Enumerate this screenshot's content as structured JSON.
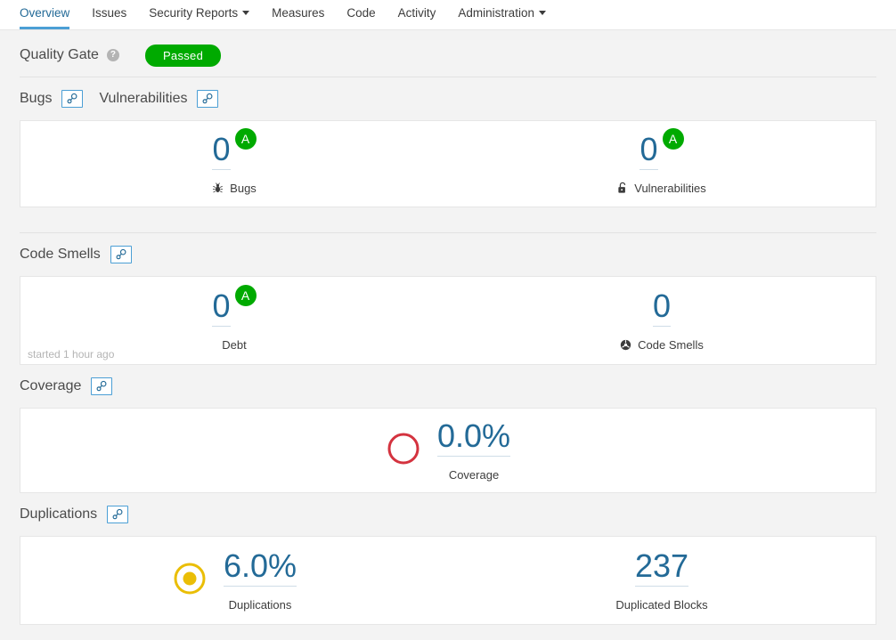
{
  "nav": {
    "items": [
      {
        "label": "Overview",
        "active": true,
        "caret": false
      },
      {
        "label": "Issues",
        "active": false,
        "caret": false
      },
      {
        "label": "Security Reports",
        "active": false,
        "caret": true
      },
      {
        "label": "Measures",
        "active": false,
        "caret": false
      },
      {
        "label": "Code",
        "active": false,
        "caret": false
      },
      {
        "label": "Activity",
        "active": false,
        "caret": false
      },
      {
        "label": "Administration",
        "active": false,
        "caret": true
      }
    ]
  },
  "quality_gate": {
    "title": "Quality Gate",
    "help_glyph": "?",
    "status": "Passed",
    "status_color": "#00aa00"
  },
  "sections": {
    "bugs_vulnerabilities": {
      "title_left": "Bugs",
      "title_right": "Vulnerabilities",
      "left": {
        "value": "0",
        "rating": "A",
        "rating_color": "#00aa00",
        "label": "Bugs",
        "icon": "bug-icon"
      },
      "right": {
        "value": "0",
        "rating": "A",
        "rating_color": "#00aa00",
        "label": "Vulnerabilities",
        "icon": "open-lock-icon"
      }
    },
    "code_smells": {
      "title": "Code Smells",
      "footer": "started 1 hour ago",
      "left": {
        "value": "0",
        "rating": "A",
        "rating_color": "#00aa00",
        "label": "Debt",
        "icon": ""
      },
      "right": {
        "value": "0",
        "rating": "",
        "label": "Code Smells",
        "icon": "code-smell-icon"
      }
    },
    "coverage": {
      "title": "Coverage",
      "value": "0.0%",
      "label": "Coverage",
      "gauge_color": "#d4333f",
      "gauge_fill": 0
    },
    "duplications": {
      "title": "Duplications",
      "left": {
        "value": "6.0%",
        "label": "Duplications",
        "gauge_color": "#eabe06",
        "gauge_fill": 0.45
      },
      "right": {
        "value": "237",
        "label": "Duplicated Blocks"
      }
    }
  },
  "icons": {
    "link": "link-icon"
  }
}
